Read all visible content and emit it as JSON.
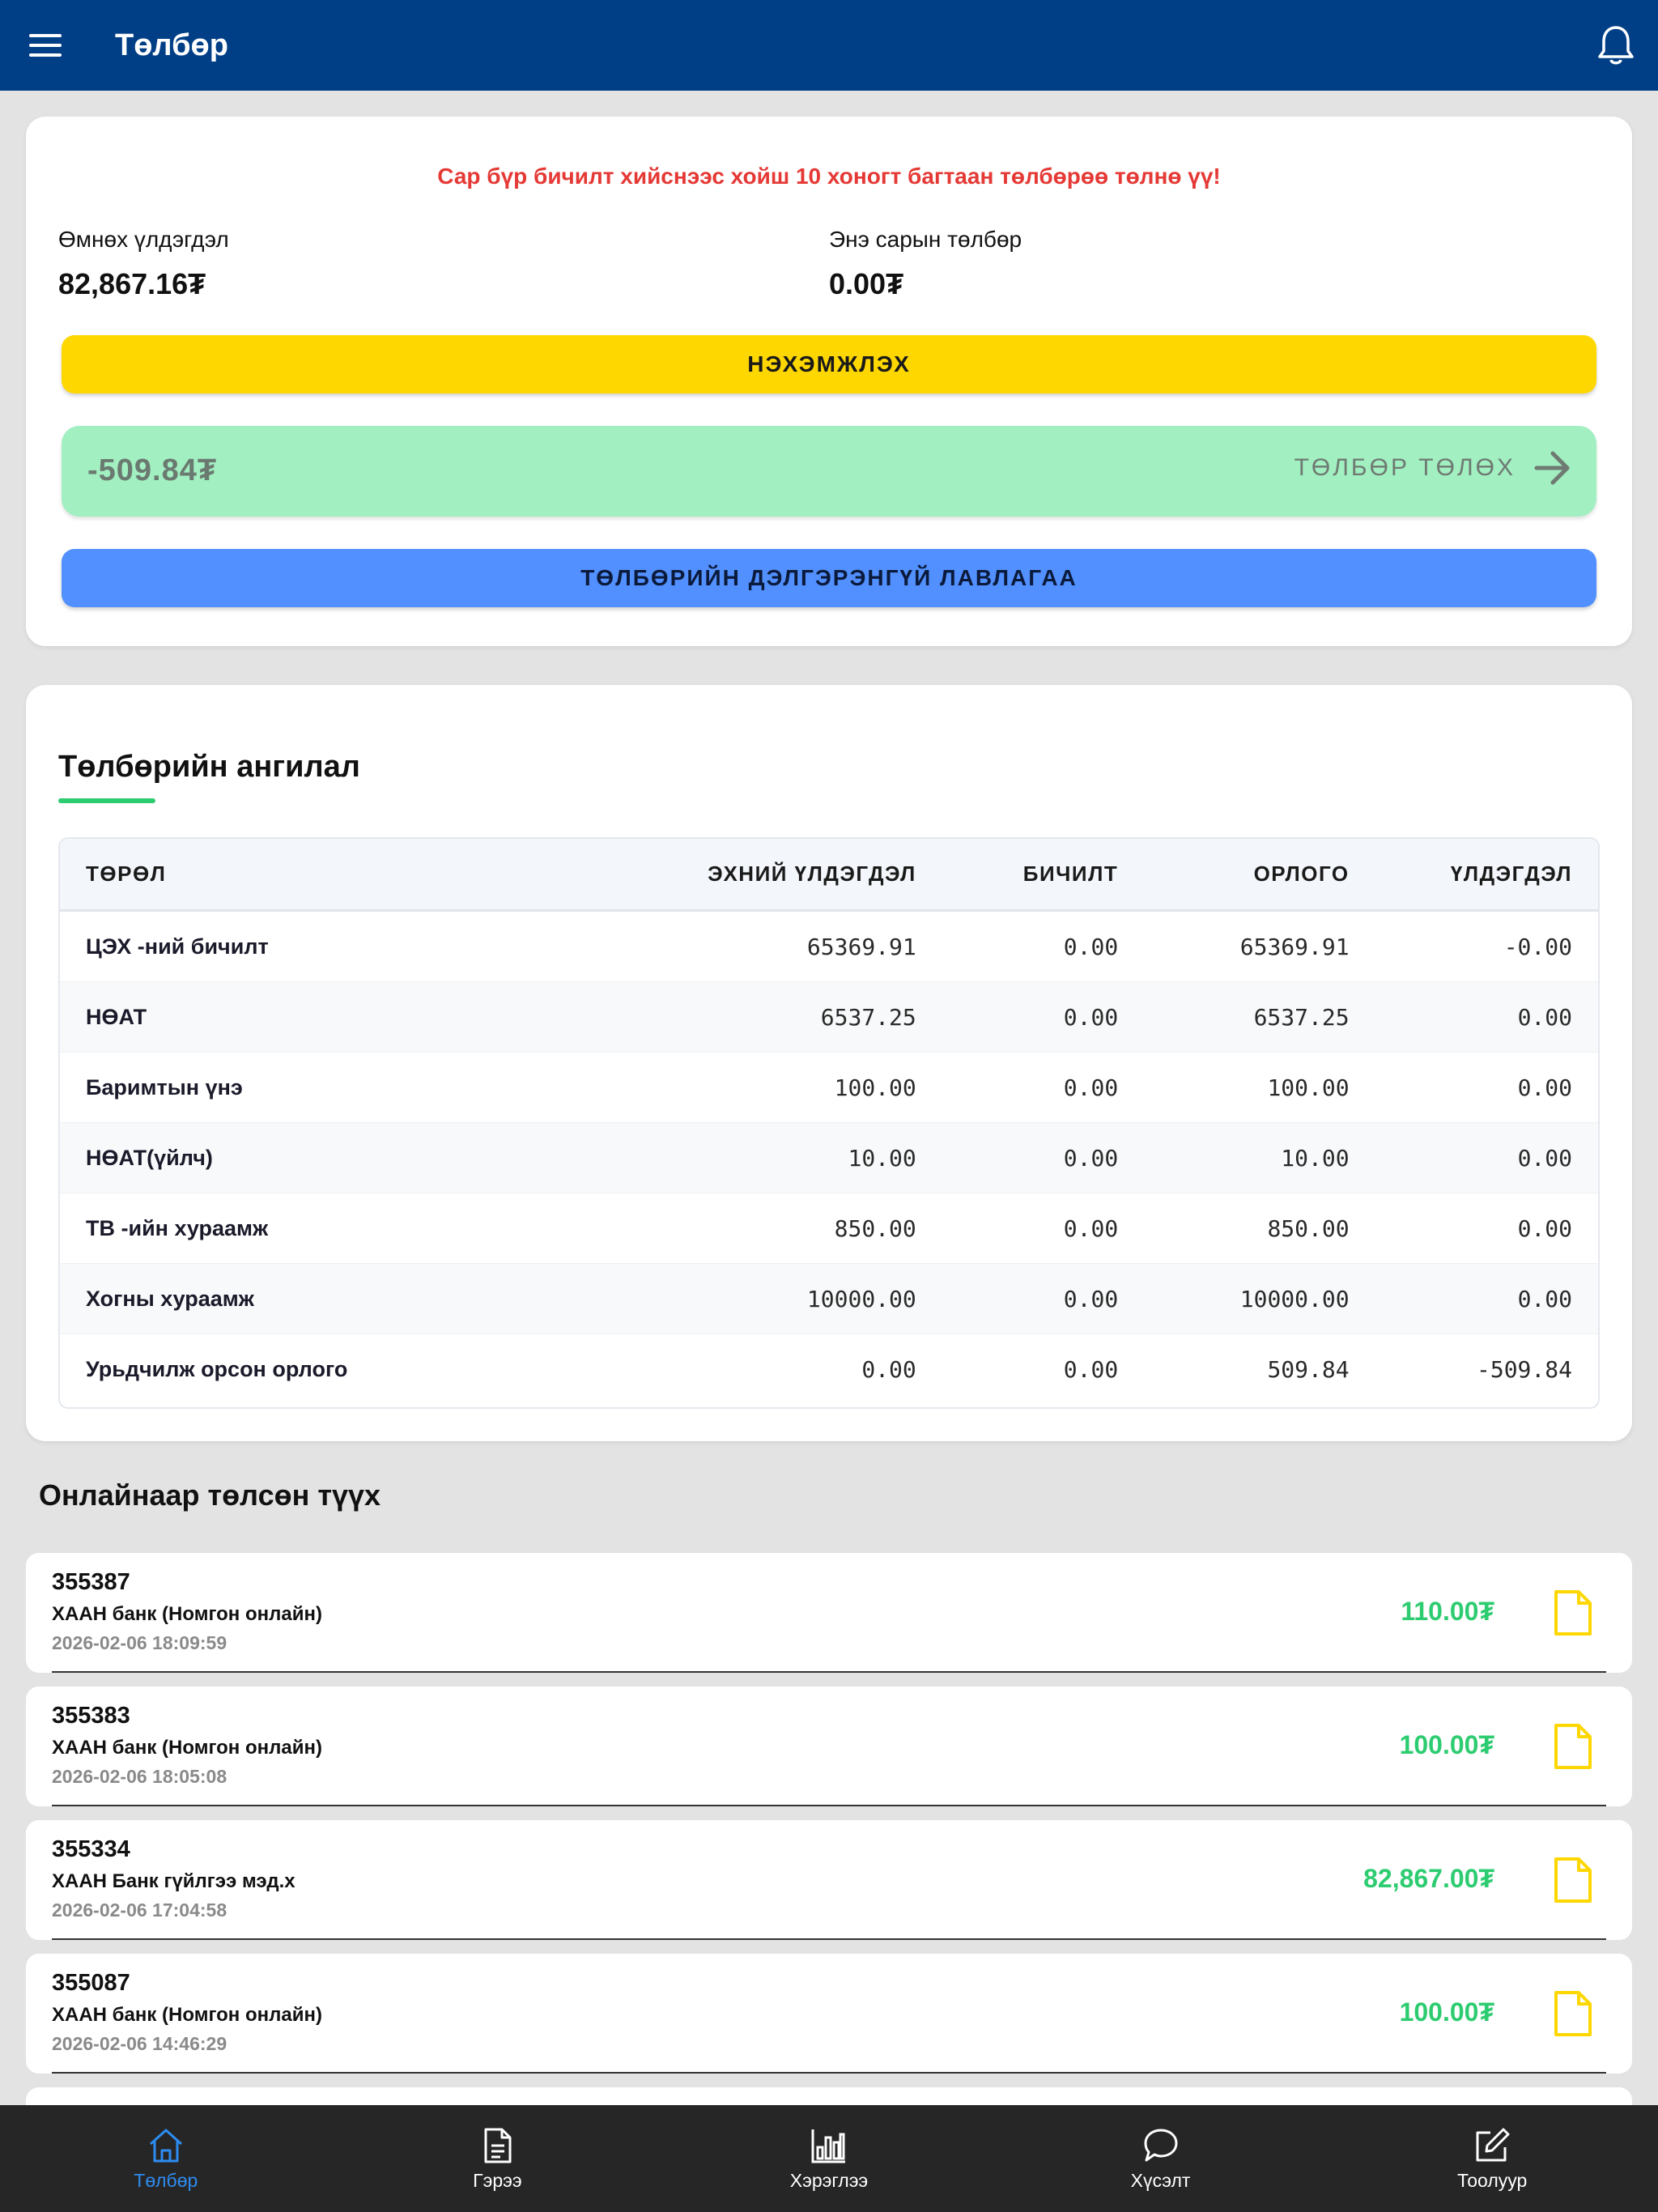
{
  "appbar": {
    "title": "Төлбөр",
    "menu_icon": "hamburger-menu-icon",
    "bell_icon": "bell-icon"
  },
  "summary": {
    "notice": "Сар бүр бичилт хийснээс хойш 10 хоногт багтаан төлбөрөө төлнө үү!",
    "prev_balance_label": "Өмнөх үлдэгдэл",
    "prev_balance_value": "82,867.16₮",
    "this_month_label": "Энэ сарын төлбөр",
    "this_month_value": "0.00₮",
    "invoice_button": "НЭХЭМЖЛЭХ",
    "pay_amount": "-509.84₮",
    "pay_button": "ТӨЛБӨР ТӨЛӨХ",
    "detail_button": "ТӨЛБӨРИЙН ДЭЛГЭРЭНГҮЙ ЛАВЛАГАА"
  },
  "category": {
    "title": "Төлбөрийн ангилал",
    "headers": [
      "ТӨРӨЛ",
      "ЭХНИЙ ҮЛДЭГДЭЛ",
      "БИЧИЛТ",
      "ОРЛОГО",
      "ҮЛДЭГДЭЛ"
    ],
    "rows": [
      [
        "ЦЭХ -ний бичилт",
        "65369.91",
        "0.00",
        "65369.91",
        "-0.00"
      ],
      [
        "НӨАТ",
        "6537.25",
        "0.00",
        "6537.25",
        "0.00"
      ],
      [
        "Баримтын үнэ",
        "100.00",
        "0.00",
        "100.00",
        "0.00"
      ],
      [
        "НӨАТ(үйлч)",
        "10.00",
        "0.00",
        "10.00",
        "0.00"
      ],
      [
        "ТВ -ийн хураамж",
        "850.00",
        "0.00",
        "850.00",
        "0.00"
      ],
      [
        "Хогны хураамж",
        "10000.00",
        "0.00",
        "10000.00",
        "0.00"
      ],
      [
        "Урьдчилж орсон орлого",
        "0.00",
        "0.00",
        "509.84",
        "-509.84"
      ]
    ]
  },
  "history": {
    "title": "Онлайнаар төлсөн түүх",
    "items": [
      {
        "id": "355387",
        "bank": "ХААН банк (Номгон онлайн)",
        "date": "2026-02-06 18:09:59",
        "amount": "110.00₮"
      },
      {
        "id": "355383",
        "bank": "ХААН банк (Номгон онлайн)",
        "date": "2026-02-06 18:05:08",
        "amount": "100.00₮"
      },
      {
        "id": "355334",
        "bank": "ХААН Банк гүйлгээ мэд.х",
        "date": "2026-02-06 17:04:58",
        "amount": "82,867.00₮"
      },
      {
        "id": "355087",
        "bank": "ХААН банк (Номгон онлайн)",
        "date": "2026-02-06 14:46:29",
        "amount": "100.00₮"
      }
    ]
  },
  "nav": {
    "items": [
      {
        "label": "Төлбөр",
        "icon": "home-icon",
        "active": true
      },
      {
        "label": "Гэрээ",
        "icon": "document-icon",
        "active": false
      },
      {
        "label": "Хэрэглээ",
        "icon": "bar-chart-icon",
        "active": false
      },
      {
        "label": "Хүсэлт",
        "icon": "chat-bubble-icon",
        "active": false
      },
      {
        "label": "Тоолуур",
        "icon": "edit-icon",
        "active": false
      }
    ]
  },
  "colors": {
    "appbar": "#003e86",
    "invoice_button": "#fed700",
    "pay_bar": "#a2efc1",
    "detail_button": "#5290ff",
    "notice": "#e53935",
    "amount": "#2ecc71",
    "nav_active": "#2d8cf0"
  }
}
